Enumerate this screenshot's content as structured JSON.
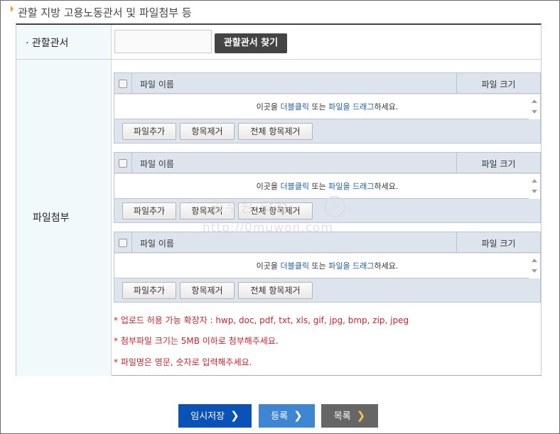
{
  "section": {
    "title": "관할 지방 고용노동관서 및 파일첨부 등"
  },
  "office_row": {
    "label": "· 관할관서",
    "input_value": "",
    "find_button": "관할관서 찾기"
  },
  "file_row": {
    "label": "파일첨부"
  },
  "uploaders": [
    {
      "col_name": "파일 이름",
      "col_size": "파일 크기",
      "drop_pre": "이곳을 ",
      "drop_dbl": "더블클릭",
      "drop_mid": " 또는 ",
      "drop_drag": "파일을 드래그",
      "drop_post": "하세요.",
      "add": "파일추가",
      "remove": "항목제거",
      "remove_all": "전체 항목제거"
    },
    {
      "col_name": "파일 이름",
      "col_size": "파일 크기",
      "drop_pre": "이곳을 ",
      "drop_dbl": "더블클릭",
      "drop_mid": " 또는 ",
      "drop_drag": "파일을 드래그",
      "drop_post": "하세요.",
      "add": "파일추가",
      "remove": "항목제거",
      "remove_all": "전체 항목제거"
    },
    {
      "col_name": "파일 이름",
      "col_size": "파일 크기",
      "drop_pre": "이곳을 ",
      "drop_dbl": "더블클릭",
      "drop_mid": " 또는 ",
      "drop_drag": "파일을 드래그",
      "drop_post": "하세요.",
      "add": "파일추가",
      "remove": "항목제거",
      "remove_all": "전체 항목제거"
    }
  ],
  "notes": [
    "* 업로드 허용 가능 확장자 : hwp, doc, pdf, txt, xls, gif, jpg, bmp, zip, jpeg",
    "* 첨부파일 크기는 5MB 이하로 첨부해주세요.",
    "* 파일명은 영문, 숫자로 입력해주세요."
  ],
  "watermark": {
    "line1": "공무원 닷컴",
    "line2": "http://0muwon.com",
    "badge": "①"
  },
  "buttons": {
    "temp_save": "임시저장",
    "register": "등록",
    "list": "목록",
    "chevron": "❯"
  },
  "colors": {
    "primary": "#0a52b5",
    "secondary": "#3f86d2",
    "neutral": "#666666",
    "note": "#d2232a",
    "accent": "#f29b26"
  }
}
